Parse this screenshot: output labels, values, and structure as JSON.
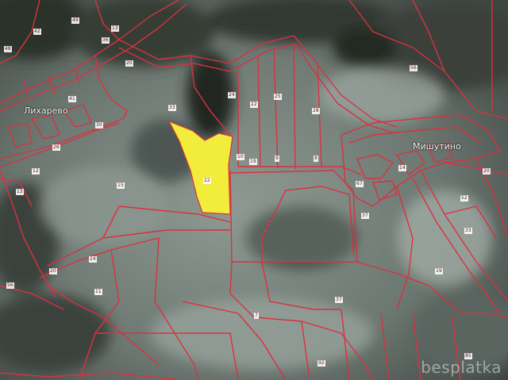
{
  "map": {
    "settlements": [
      {
        "id": "likharevo",
        "label": "Лихарево"
      },
      {
        "id": "mishutino",
        "label": "Мишутино"
      }
    ],
    "highlight_color": "#f2ec3a",
    "boundary_color": "#d8323f",
    "parcel_labels": [
      "48",
      "49",
      "42",
      "36",
      "13",
      "20",
      "33",
      "22",
      "24",
      "25",
      "28",
      "56",
      "8",
      "9",
      "10",
      "19",
      "22",
      "15",
      "12",
      "13",
      "26",
      "30",
      "41",
      "67",
      "37",
      "14",
      "52",
      "20",
      "33",
      "19",
      "24",
      "20",
      "11",
      "56",
      "7",
      "37",
      "85",
      "92"
    ],
    "watermark": "besplatka"
  }
}
